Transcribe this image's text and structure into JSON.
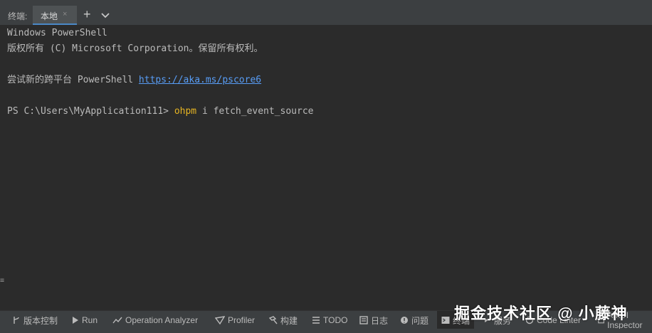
{
  "panel": {
    "title": "终端:",
    "tab_label": "本地",
    "tab_close": "×",
    "add_symbol": "+"
  },
  "terminal": {
    "line1": "Windows PowerShell",
    "line2": "版权所有 (C) Microsoft Corporation。保留所有权利。",
    "line3_prefix": "尝试新的跨平台 PowerShell ",
    "line3_link": "https://aka.ms/pscore6",
    "prompt": "PS C:\\Users\\MyApplication111> ",
    "command": "ohpm",
    "command_args": " i fetch_event_source"
  },
  "toolbar": {
    "version_control": "版本控制",
    "run": "Run",
    "operation_analyzer": "Operation Analyzer",
    "profiler": "Profiler",
    "build": "构建",
    "todo": "TODO",
    "log": "日志",
    "problems": "问题",
    "terminal": "终端",
    "services": "服务",
    "code_linter": "Code Linter",
    "arkui_inspector": "ArkUI Inspector"
  },
  "watermark": {
    "text": "掘金技术社区 @ 小藤神"
  },
  "colors": {
    "background": "#2b2b2b",
    "panel": "#3c3f41",
    "accent": "#4a88c7",
    "link": "#589df6",
    "command": "#e6b422"
  }
}
